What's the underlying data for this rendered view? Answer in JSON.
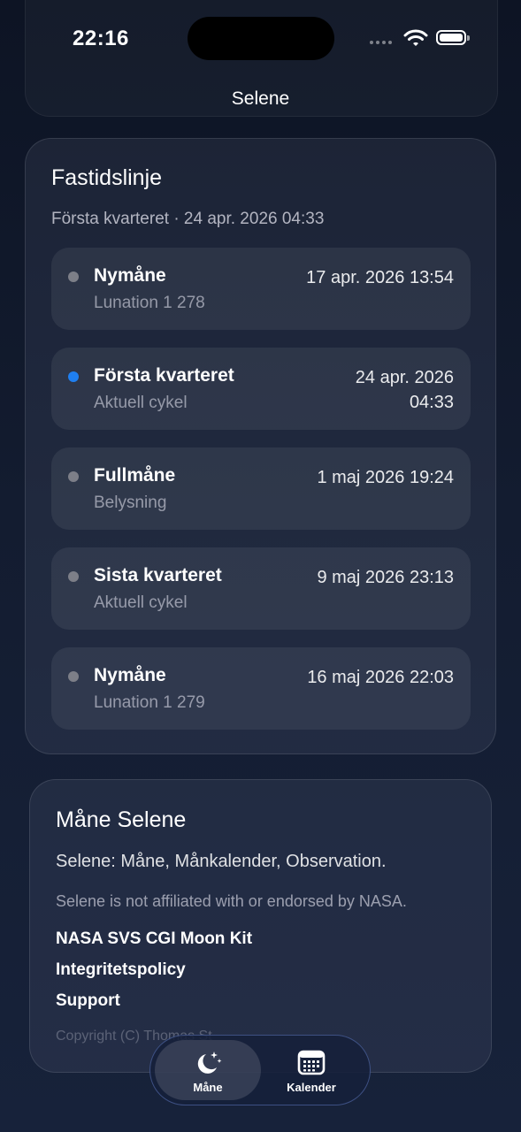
{
  "status": {
    "time": "22:16"
  },
  "nav": {
    "title": "Selene"
  },
  "timeline": {
    "title": "Fastidslinje",
    "subtitle": "Första kvarteret · 24 apr. 2026 04:33",
    "rows": [
      {
        "phase": "Nymåne",
        "detail": "Lunation 1 278",
        "date": "17 apr. 2026 13:54",
        "active": false
      },
      {
        "phase": "Första kvarteret",
        "detail": "Aktuell cykel",
        "date": "24 apr. 2026 04:33",
        "active": true
      },
      {
        "phase": "Fullmåne",
        "detail": "Belysning",
        "date": "1 maj 2026 19:24",
        "active": false
      },
      {
        "phase": "Sista kvarteret",
        "detail": "Aktuell cykel",
        "date": "9 maj 2026 23:13",
        "active": false
      },
      {
        "phase": "Nymåne",
        "detail": "Lunation 1 279",
        "date": "16 maj 2026 22:03",
        "active": false
      }
    ]
  },
  "about": {
    "title": "Måne Selene",
    "description": "Selene: Måne, Månkalender, Observation.",
    "disclaimer": "Selene is not affiliated with or endorsed by NASA.",
    "links": [
      "NASA SVS CGI Moon Kit",
      "Integritetspolicy",
      "Support"
    ],
    "copyright": "Copyright (C) Thomas St"
  },
  "tabbar": {
    "tabs": [
      {
        "label": "Måne",
        "icon": "moon-stars-icon",
        "selected": true
      },
      {
        "label": "Kalender",
        "icon": "calendar-icon",
        "selected": false
      }
    ]
  },
  "colors": {
    "active_dot": "#1f7ff0",
    "inactive_dot": "#7d7f88"
  }
}
